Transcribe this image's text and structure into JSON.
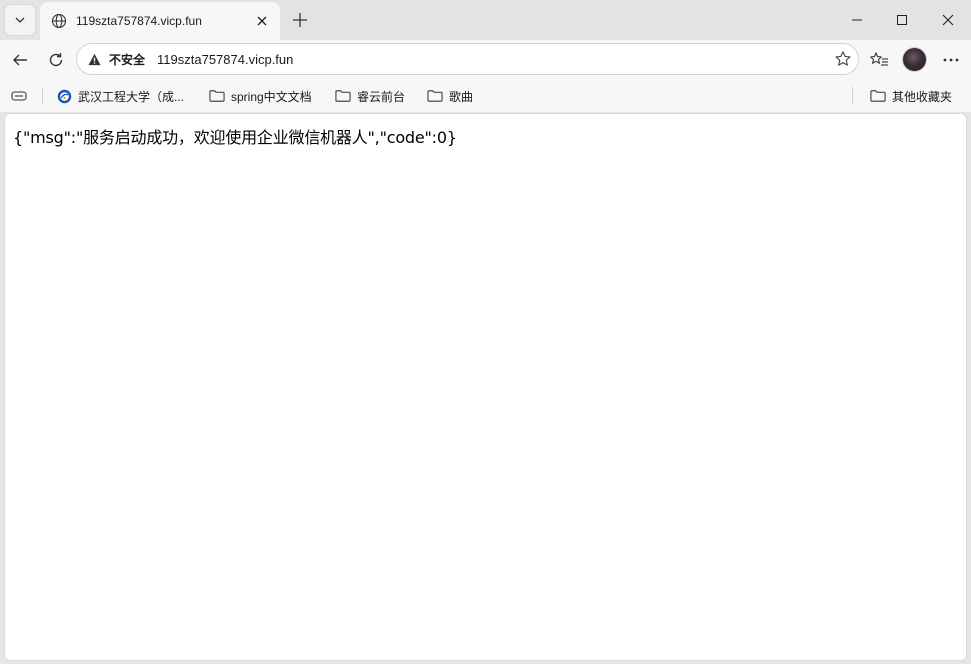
{
  "tab": {
    "title": "119szta757874.vicp.fun",
    "icon": "globe-icon"
  },
  "address_bar": {
    "security_label": "不安全",
    "url": "119szta757874.vicp.fun",
    "security_icon": "warning-icon"
  },
  "bookmarks": [
    {
      "label": "武汉工程大学（成...",
      "icon": "site-logo-icon"
    },
    {
      "label": "spring中文文档",
      "icon": "folder-icon"
    },
    {
      "label": "睿云前台",
      "icon": "folder-icon"
    },
    {
      "label": "歌曲",
      "icon": "folder-icon"
    }
  ],
  "other_bookmarks": {
    "label": "其他收藏夹",
    "icon": "folder-icon"
  },
  "page": {
    "body_text": "{\"msg\":\"服务启动成功，欢迎使用企业微信机器人\",\"code\":0}"
  },
  "colors": {
    "titlebar": "#e3e3e3",
    "toolbar": "#f7f7f7",
    "content": "#ffffff"
  }
}
